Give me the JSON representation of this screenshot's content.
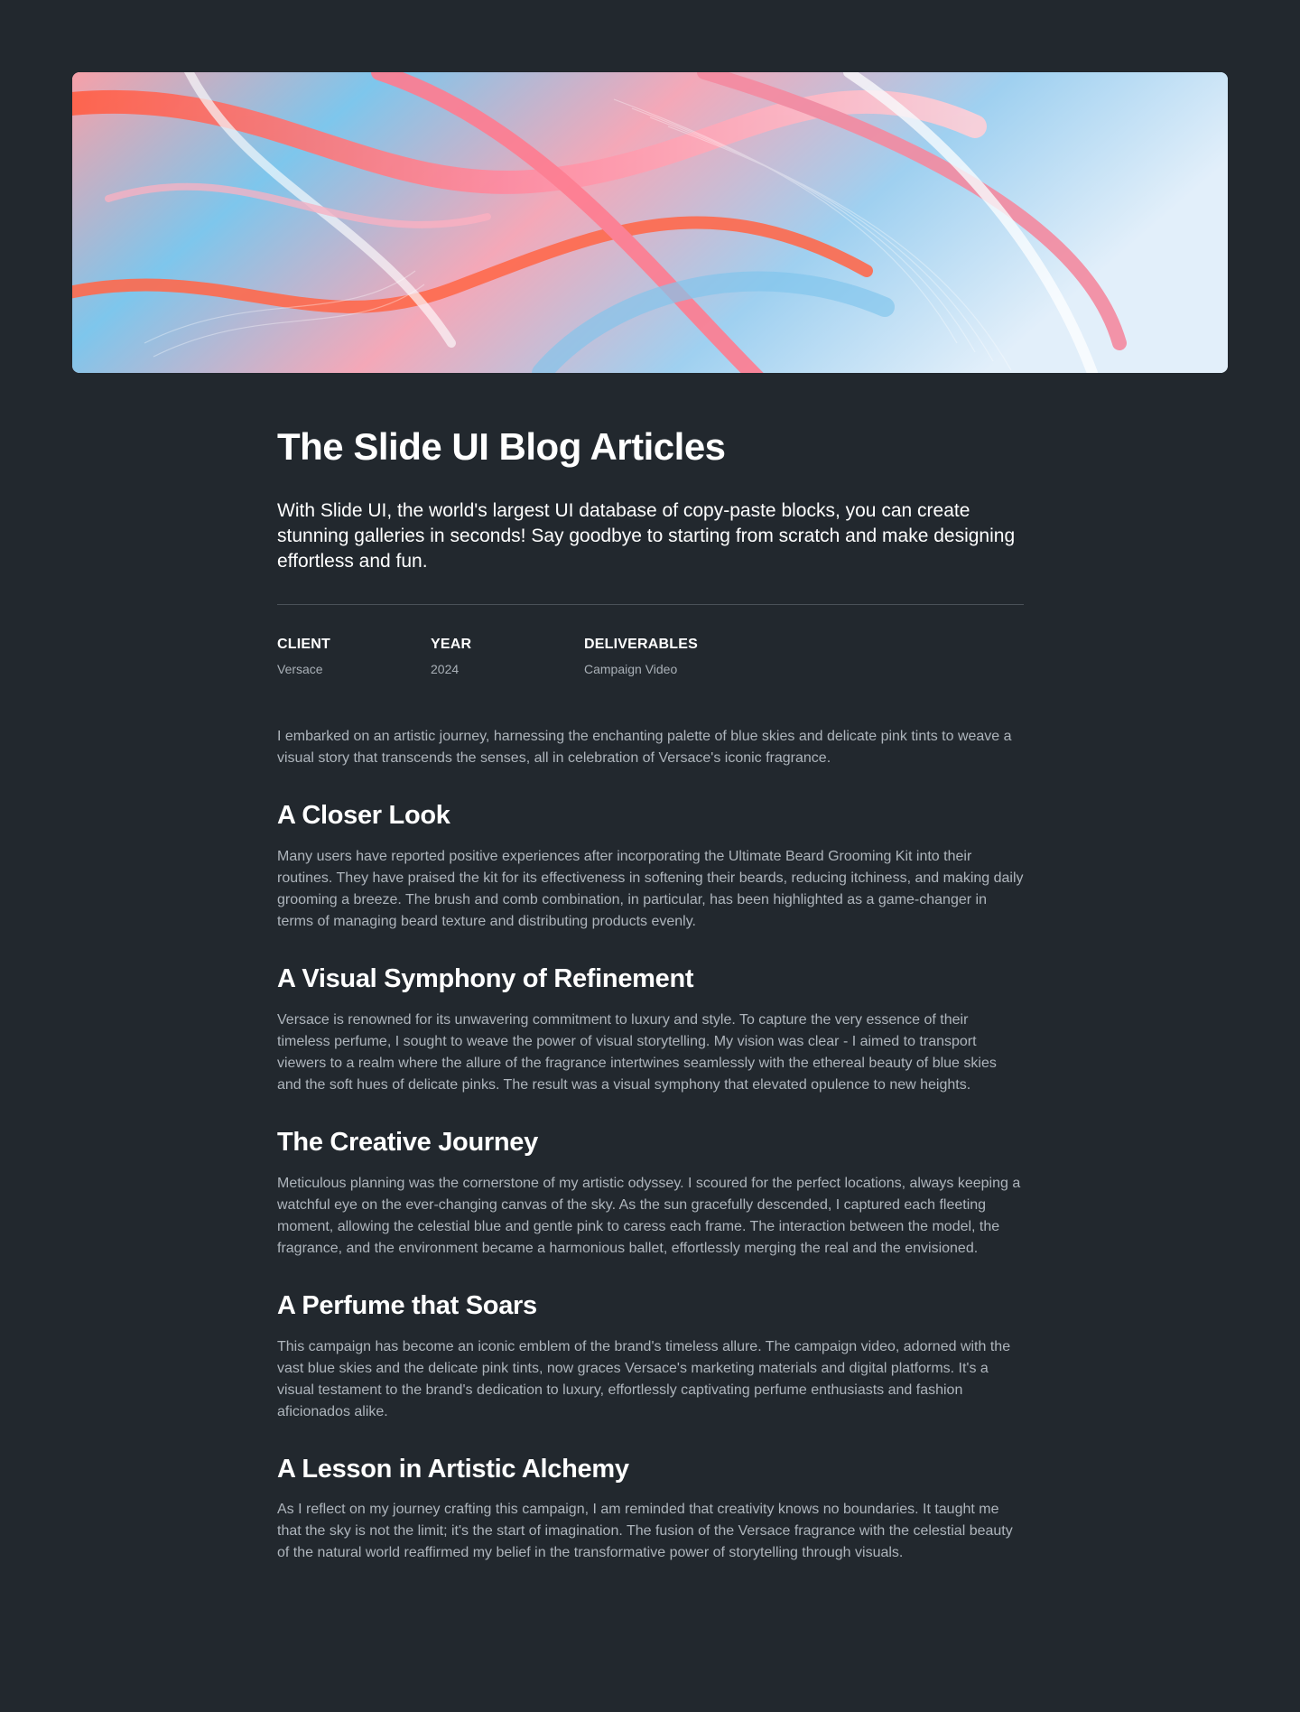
{
  "hero": {
    "image_icon": "abstract-ribbon-image",
    "colors": [
      "#ff6a4d",
      "#f79aa8",
      "#7cc8ee",
      "#e7f2fb"
    ]
  },
  "article": {
    "title": "The Slide UI Blog Articles",
    "lead": "With Slide UI, the world's largest UI database of copy-paste blocks, you can create stunning galleries in seconds! Say goodbye to starting from scratch and make designing effortless and fun.",
    "meta": [
      {
        "label": "CLIENT",
        "value": "Versace"
      },
      {
        "label": "YEAR",
        "value": "2024"
      },
      {
        "label": "DELIVERABLES",
        "value": "Campaign Video"
      }
    ],
    "intro": "I embarked on an artistic journey, harnessing the enchanting palette of blue skies and delicate pink tints to weave a visual story that transcends the senses, all in celebration of Versace's iconic fragrance.",
    "sections": [
      {
        "title": "A Closer Look",
        "body": "Many users have reported positive experiences after incorporating the Ultimate Beard Grooming Kit into their routines. They have praised the kit for its effectiveness in softening their beards, reducing itchiness, and making daily grooming a breeze. The brush and comb combination, in particular, has been highlighted as a game-changer in terms of managing beard texture and distributing products evenly."
      },
      {
        "title": "A Visual Symphony of Refinement",
        "body": "Versace is renowned for its unwavering commitment to luxury and style. To capture the very essence of their timeless perfume, I sought to weave the power of visual storytelling. My vision was clear - I aimed to transport viewers to a realm where the allure of the fragrance intertwines seamlessly with the ethereal beauty of blue skies and the soft hues of delicate pinks. The result was a visual symphony that elevated opulence to new heights."
      },
      {
        "title": "The Creative Journey",
        "body": "Meticulous planning was the cornerstone of my artistic odyssey. I scoured for the perfect locations, always keeping a watchful eye on the ever-changing canvas of the sky. As the sun gracefully descended, I captured each fleeting moment, allowing the celestial blue and gentle pink to caress each frame. The interaction between the model, the fragrance, and the environment became a harmonious ballet, effortlessly merging the real and the envisioned."
      },
      {
        "title": "A Perfume that Soars",
        "body": "This campaign has become an iconic emblem of the brand's timeless allure. The campaign video, adorned with the vast blue skies and the delicate pink tints, now graces Versace's marketing materials and digital platforms. It's a visual testament to the brand's dedication to luxury, effortlessly captivating perfume enthusiasts and fashion aficionados alike."
      },
      {
        "title": "A Lesson in Artistic Alchemy",
        "body": "As I reflect on my journey crafting this campaign, I am reminded that creativity knows no boundaries. It taught me that the sky is not the limit; it's the start of imagination. The fusion of the Versace fragrance with the celestial beauty of the natural world reaffirmed my belief in the transformative power of storytelling through visuals."
      }
    ]
  }
}
